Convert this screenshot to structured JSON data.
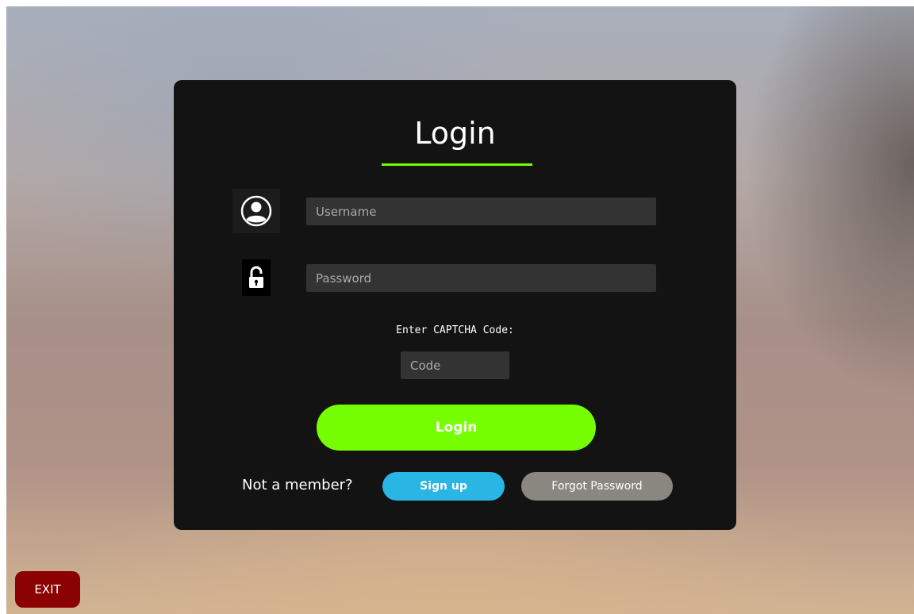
{
  "login_card": {
    "title": "Login",
    "username_placeholder": "Username",
    "password_placeholder": "Password",
    "captcha_label": "Enter CAPTCHA Code:",
    "code_placeholder": "Code",
    "login_button_label": "Login",
    "member_prompt": "Not a member?",
    "signup_button_label": "Sign up",
    "forgot_password_label": "Forgot Password"
  },
  "exit_button_label": "EXIT",
  "icons": {
    "user": "user-avatar-icon",
    "lock": "unlocked-padlock-icon"
  },
  "colors": {
    "card_background": "#131313",
    "accent_green": "#76ff03",
    "signup_blue": "#29b6e5",
    "forgot_gray": "#8a8680",
    "exit_red": "#8b0000",
    "input_background": "#333333"
  }
}
